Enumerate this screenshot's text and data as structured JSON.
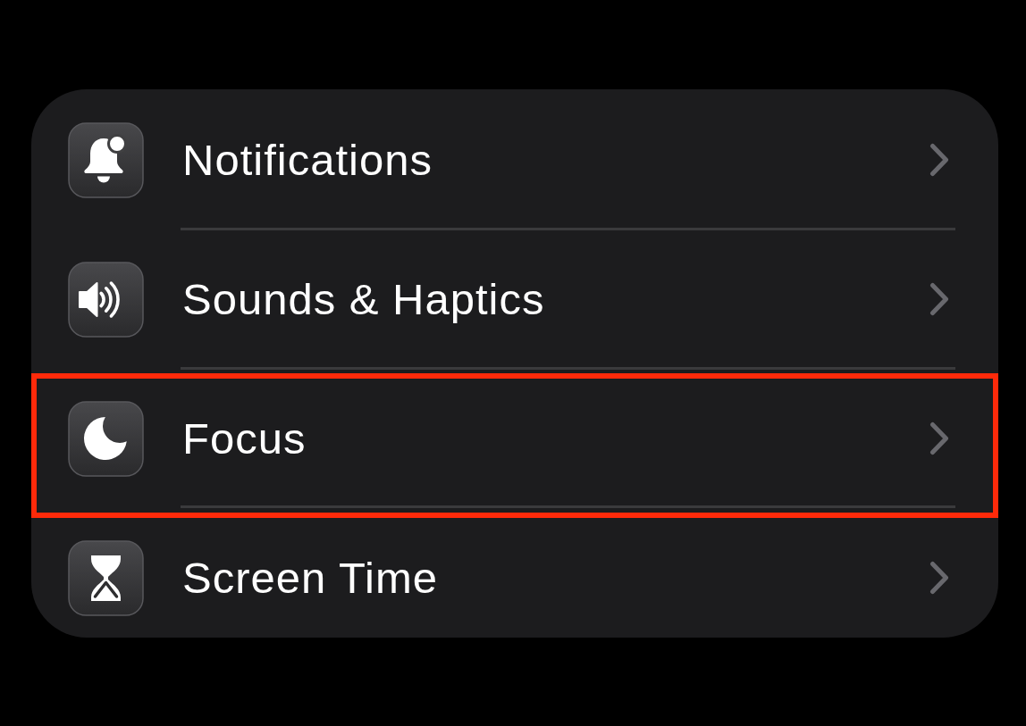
{
  "settings_group": {
    "items": [
      {
        "label": "Notifications",
        "kind": "notifications",
        "highlighted": false
      },
      {
        "label": "Sounds & Haptics",
        "kind": "sounds",
        "highlighted": false
      },
      {
        "label": "Focus",
        "kind": "focus",
        "highlighted": true
      },
      {
        "label": "Screen Time",
        "kind": "screen_time",
        "highlighted": false
      }
    ]
  }
}
